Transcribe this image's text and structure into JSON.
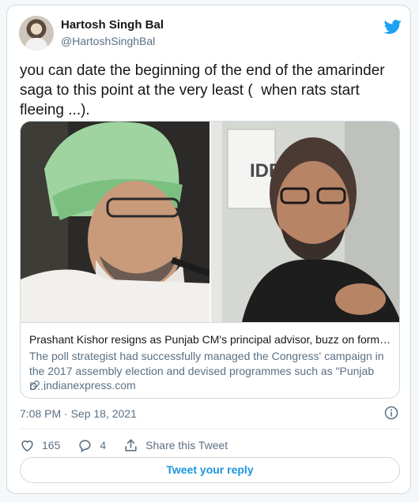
{
  "author": {
    "name": "Hartosh Singh Bal",
    "handle": "@HartoshSinghBal"
  },
  "tweet": {
    "text": "you can date the beginning of the end of the amarinder saga to this point at the very least (  when rats start fleeing ...)."
  },
  "link_card": {
    "title": "Prashant Kishor resigns as Punjab CM's principal advisor, buzz on formal...",
    "description": "The poll strategist had successfully managed the Congress' campaign in the 2017 assembly election and devised programmes such as \"Punjab D...",
    "domain": "indianexpress.com",
    "photo_sign_text": "IDE"
  },
  "meta": {
    "timestamp": "7:08 PM · Sep 18, 2021"
  },
  "actions": {
    "likes": "165",
    "replies": "4",
    "share_label": "Share this Tweet",
    "reply_button": "Tweet your reply"
  },
  "colors": {
    "accent": "#1da1f2",
    "reply_button_text": "#1b95e0",
    "like_color": "#5b7083"
  },
  "icons": [
    "twitter-bird-icon",
    "info-icon",
    "heart-icon",
    "comment-icon",
    "share-icon",
    "link-icon"
  ]
}
